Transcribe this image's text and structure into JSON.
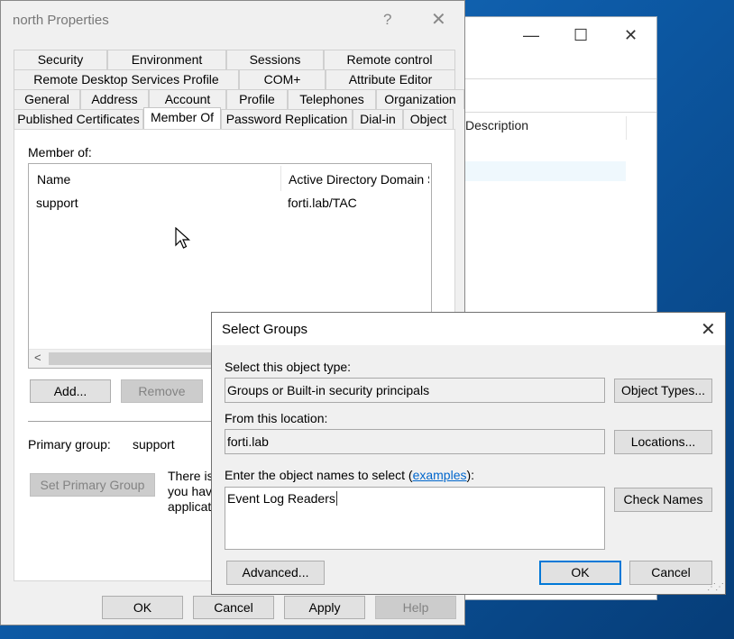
{
  "background_window": {
    "controls": {
      "minimize": "—",
      "maximize": "☐",
      "close": "✕"
    },
    "column_description": "Description"
  },
  "properties_dialog": {
    "title": "north Properties",
    "help_glyph": "?",
    "close_glyph": "✕",
    "tabs_row1": [
      "Security",
      "Environment",
      "Sessions",
      "Remote control"
    ],
    "tabs_row2": [
      "Remote Desktop Services Profile",
      "COM+",
      "Attribute Editor"
    ],
    "tabs_row3": [
      "General",
      "Address",
      "Account",
      "Profile",
      "Telephones",
      "Organization"
    ],
    "tabs_row4": [
      "Published Certificates",
      "Member Of",
      "Password Replication",
      "Dial-in",
      "Object"
    ],
    "active_tab": "Member Of",
    "member_of_label": "Member of:",
    "columns": {
      "name": "Name",
      "folder": "Active Directory Domain S"
    },
    "rows": [
      {
        "name": "support",
        "folder": "forti.lab/TAC"
      }
    ],
    "scroll_left_glyph": "<",
    "add_button": "Add...",
    "remove_button": "Remove",
    "primary_group_label": "Primary group:",
    "primary_group_value": "support",
    "set_primary_button": "Set Primary Group",
    "note_line1": "There is",
    "note_line2": "you have",
    "note_line3": "applicati",
    "ok_button": "OK",
    "cancel_button": "Cancel",
    "apply_button": "Apply",
    "help_button": "Help"
  },
  "select_groups": {
    "title": "Select Groups",
    "close_glyph": "✕",
    "object_type_label": "Select this object type:",
    "object_type_value": "Groups or Built-in security principals",
    "object_types_button": "Object Types...",
    "location_label": "From this location:",
    "location_value": "forti.lab",
    "locations_button": "Locations...",
    "names_label_prefix": "Enter the object names to select (",
    "names_label_link": "examples",
    "names_label_suffix": "):",
    "names_value": "Event Log Readers",
    "check_names_button": "Check Names",
    "advanced_button": "Advanced...",
    "ok_button": "OK",
    "cancel_button": "Cancel"
  },
  "colors": {
    "accent": "#0078d7",
    "link": "#0066cc",
    "desktop": "#0d5aa6"
  }
}
